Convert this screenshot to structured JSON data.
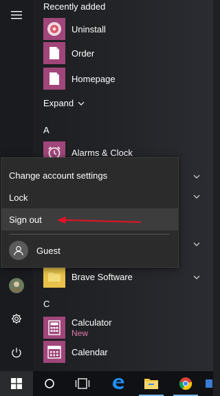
{
  "start_menu": {
    "recently_added_header": "Recently added",
    "recent_items": [
      {
        "label": "Uninstall",
        "icon": "uninstall-icon"
      },
      {
        "label": "Order",
        "icon": "document-icon"
      },
      {
        "label": "Homepage",
        "icon": "document-icon"
      }
    ],
    "expand_label": "Expand",
    "section_a": "A",
    "alarms_label": "Alarms & Clock",
    "brave_label": "Brave Software",
    "section_c": "C",
    "calculator_label": "Calculator",
    "calculator_badge": "New",
    "calendar_label": "Calendar"
  },
  "account_menu": {
    "change_settings": "Change account settings",
    "lock": "Lock",
    "sign_out": "Sign out",
    "user_name": "Guest"
  },
  "colors": {
    "tile_pink": "#a0467a",
    "tile_yellow": "#e8c24a",
    "accent_blue": "#76b9ed",
    "arrow_red": "#e81123"
  }
}
